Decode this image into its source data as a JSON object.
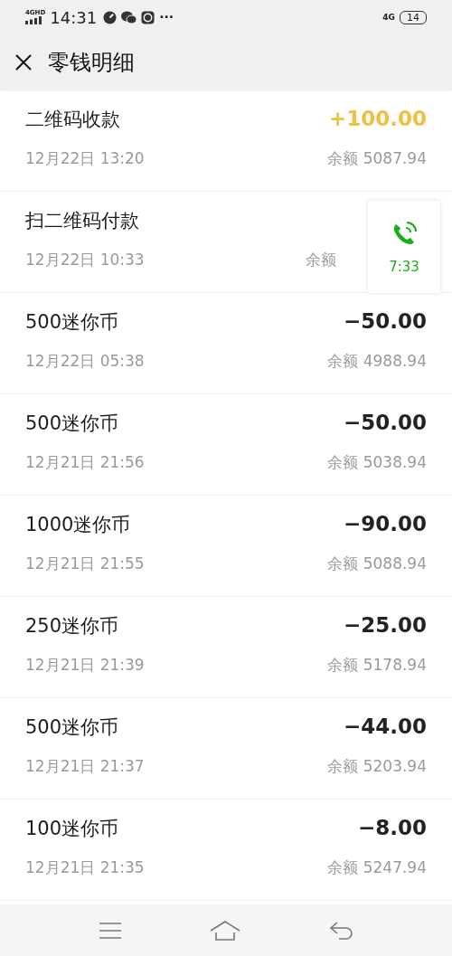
{
  "status_bar": {
    "network": "4GHD",
    "time": "14:31",
    "more": "···",
    "right_network": "4G",
    "battery": "14"
  },
  "header": {
    "title": "零钱明细"
  },
  "transactions": [
    {
      "title": "二维码收款",
      "amount": "+100.00",
      "kind": "income",
      "date": "12月22日 13:20",
      "balance": "余额 5087.94"
    },
    {
      "title": "扫二维码付款",
      "kind": "expense",
      "date": "12月22日 10:33",
      "balance": "余额"
    },
    {
      "title": "500迷你币",
      "amount": "−50.00",
      "kind": "expense",
      "date": "12月22日 05:38",
      "balance": "余额 4988.94"
    },
    {
      "title": "500迷你币",
      "amount": "−50.00",
      "kind": "expense",
      "date": "12月21日 21:56",
      "balance": "余额 5038.94"
    },
    {
      "title": "1000迷你币",
      "amount": "−90.00",
      "kind": "expense",
      "date": "12月21日 21:55",
      "balance": "余额 5088.94"
    },
    {
      "title": "250迷你币",
      "amount": "−25.00",
      "kind": "expense",
      "date": "12月21日 21:39",
      "balance": "余额 5178.94"
    },
    {
      "title": "500迷你币",
      "amount": "−44.00",
      "kind": "expense",
      "date": "12月21日 21:37",
      "balance": "余额 5203.94"
    },
    {
      "title": "100迷你币",
      "amount": "−8.00",
      "kind": "expense",
      "date": "12月21日 21:35",
      "balance": "余额 5247.94"
    }
  ],
  "call_bubble": {
    "duration": "7:33"
  }
}
